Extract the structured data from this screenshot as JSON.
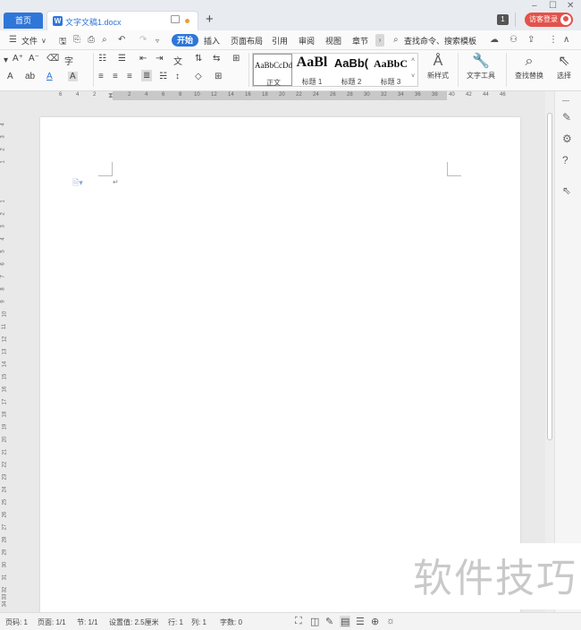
{
  "tabs": {
    "home": "首页",
    "doc_name": "文字文稿1.docx",
    "doc_icon": "W",
    "new_tab": "+"
  },
  "window": {
    "minimize": "–",
    "maximize": "☐",
    "close": "✕",
    "badge": "1",
    "login": "访客登录"
  },
  "menu": {
    "file": "文件",
    "start": "开始",
    "items": [
      "插入",
      "页面布局",
      "引用",
      "审阅",
      "视图",
      "章节"
    ],
    "search": "查找命令、搜索模板"
  },
  "ribbon": {
    "styles": [
      {
        "sample": "AaBbCcDd",
        "label": "正文"
      },
      {
        "sample": "AaBl",
        "label": "标题 1"
      },
      {
        "sample": "AaBb(",
        "label": "标题 2"
      },
      {
        "sample": "AaBbC",
        "label": "标题 3"
      }
    ],
    "new_style": "新样式",
    "text_tools": "文字工具",
    "find_replace": "查找替换",
    "select": "选择"
  },
  "ruler": {
    "h_numbers": [
      "6",
      "4",
      "2",
      "2",
      "4",
      "6",
      "8",
      "10",
      "12",
      "14",
      "16",
      "18",
      "20",
      "22",
      "24",
      "26",
      "28",
      "30",
      "32",
      "34",
      "36",
      "38",
      "40",
      "42",
      "44",
      "46"
    ],
    "v_numbers": [
      "4",
      "3",
      "2",
      "1",
      "1",
      "2",
      "3",
      "4",
      "5",
      "6",
      "7",
      "8",
      "9",
      "10",
      "11",
      "12",
      "13",
      "14",
      "15",
      "16",
      "17",
      "18",
      "19",
      "20",
      "21",
      "22",
      "23",
      "24",
      "25",
      "26",
      "27",
      "28",
      "29",
      "30",
      "31",
      "32",
      "33",
      "34"
    ]
  },
  "status": {
    "page_no": "页码: 1",
    "page": "页面: 1/1",
    "section": "节: 1/1",
    "setting": "设置值: 2.5厘米",
    "row": "行: 1",
    "col": "列: 1",
    "words": "字数: 0"
  },
  "watermark": "软件技巧",
  "colors": {
    "accent": "#2f76d9",
    "login": "#e3524a",
    "modified_dot": "#f29b38"
  }
}
